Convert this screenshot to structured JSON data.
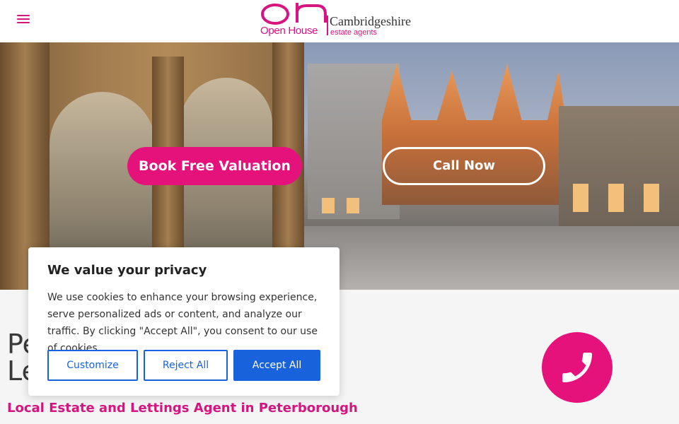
{
  "header": {
    "menu_icon": "hamburger-menu-icon",
    "logo": {
      "mark": "oh",
      "brand_text": "Open House",
      "region_text": "Cambridgeshire",
      "tagline": "estate agents"
    }
  },
  "hero": {
    "book_button_label": "Book Free Valuation",
    "call_button_label": "Call Now"
  },
  "main": {
    "title": "Peterborough Estate and Lettings Agents",
    "subtitle": "Local Estate and Lettings Agent in Peterborough",
    "phone_icon": "phone-icon"
  },
  "cookie_banner": {
    "title": "We value your privacy",
    "text": "We use cookies to enhance your browsing experience, serve personalized ads or content, and analyze our traffic. By clicking \"Accept All\", you consent to our use of cookies.",
    "customize_label": "Customize",
    "reject_label": "Reject All",
    "accept_label": "Accept All"
  },
  "colors": {
    "brand_pink": "#e5127b",
    "accent_blue": "#1863dc"
  }
}
